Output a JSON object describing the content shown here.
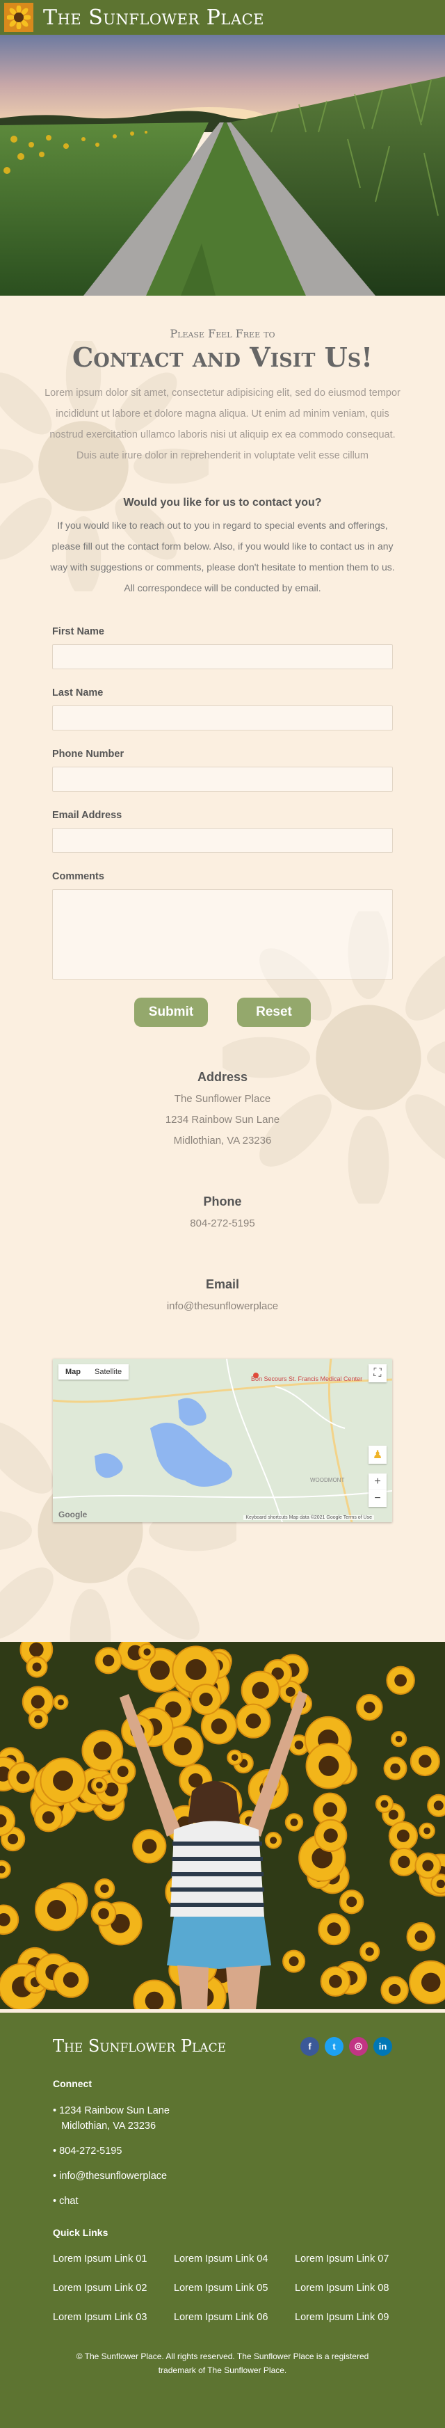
{
  "header": {
    "title": "The Sunflower Place",
    "logo_icon": "sunflower-icon"
  },
  "contact": {
    "kicker": "Please Feel Free to",
    "headline": "Contact and Visit Us!",
    "intro": "Lorem ipsum dolor sit amet, consectetur adipisicing elit, sed do eiusmod tempor incididunt ut labore et dolore magna aliqua. Ut enim ad minim veniam, quis nostrud exercitation ullamco laboris nisi ut aliquip ex ea commodo consequat. Duis aute irure dolor in reprehenderit in voluptate velit esse cillum",
    "question": "Would you like for us to contact you?",
    "explain": "If you would like to reach out to you in regard to special events and offerings, please fill out the contact form below. Also, if you would like to contact us in any way with suggestions or comments, please don't hesitate to mention them to us. All correspondece will be conducted by email."
  },
  "form": {
    "first_name_label": "First Name",
    "last_name_label": "Last Name",
    "phone_label": "Phone Number",
    "email_label": "Email Address",
    "comments_label": "Comments",
    "submit_label": "Submit",
    "reset_label": "Reset"
  },
  "address": {
    "heading": "Address",
    "name": "The Sunflower Place",
    "street": "1234 Rainbow Sun Lane",
    "city": "Midlothian, VA 23236"
  },
  "phone": {
    "heading": "Phone",
    "number": "804-272-5195"
  },
  "email": {
    "heading": "Email",
    "value": "info@thesunflowerplace"
  },
  "map": {
    "tab_map": "Map",
    "tab_satellite": "Satellite",
    "poi": "Bon Secours St. Francis Medical Center",
    "area_label": "WOODMONT",
    "google": "Google",
    "attribution": "Keyboard shortcuts   Map data ©2021 Google   Terms of Use"
  },
  "footer": {
    "title": "The Sunflower Place",
    "connect_heading": "Connect",
    "connect_address_1": "1234 Rainbow Sun Lane",
    "connect_address_2": "Midlothian, VA 23236",
    "connect_phone": "804-272-5195",
    "connect_email": "info@thesunflowerplace",
    "connect_chat": "chat",
    "quick_links_heading": "Quick Links",
    "quick_links": [
      "Lorem Ipsum Link 01",
      "Lorem Ipsum Link 04",
      "Lorem Ipsum Link 07",
      "Lorem Ipsum Link 02",
      "Lorem Ipsum Link 05",
      "Lorem Ipsum Link 08",
      "Lorem Ipsum Link 03",
      "Lorem Ipsum Link 06",
      "Lorem Ipsum Link 09"
    ],
    "copyright": "© The Sunflower Place. All rights reserved. The Sunflower Place is a registered trademark of The Sunflower Place.",
    "social": [
      {
        "name": "facebook-icon",
        "glyph": "f",
        "color": "#3b5998"
      },
      {
        "name": "twitter-icon",
        "glyph": "t",
        "color": "#1da1f2"
      },
      {
        "name": "instagram-icon",
        "glyph": "◎",
        "color": "#c13584"
      },
      {
        "name": "linkedin-icon",
        "glyph": "in",
        "color": "#0077b5"
      }
    ]
  },
  "colors": {
    "brand_green": "#5d7431",
    "button_green": "#94a86c",
    "background": "#fbefe0",
    "logo_orange": "#d98a1c"
  }
}
